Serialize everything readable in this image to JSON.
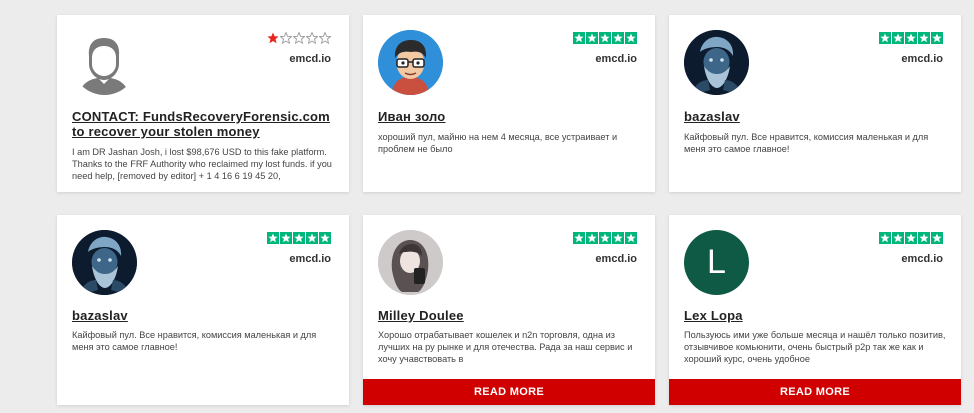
{
  "reviews": [
    {
      "name": "CONTACT: FundsRecoveryForensic.com to recover your stolen money",
      "site": "emcd.io",
      "rating": 1,
      "text": "I am DR Jashan Josh, i lost $98,676 USD to this fake platform. Thanks to the FRF Authority who reclaimed my lost funds. if you need help, [removed by editor] + 1 4 16 6 19 45 20,",
      "avatar": "default-person-icon"
    },
    {
      "name": "Иван золо",
      "site": "emcd.io",
      "rating": 5,
      "text": "хороший пул, майню на нем 4 месяца, все устраивает и проблем не было",
      "avatar": "cartoon-glasses-avatar"
    },
    {
      "name": "bazaslav",
      "site": "emcd.io",
      "rating": 5,
      "text": "Кайфовый пул. Все нравится, комиссия маленькая и для меня это самое главное!",
      "avatar": "poseidon-avatar"
    },
    {
      "name": "bazaslav",
      "site": "emcd.io",
      "rating": 5,
      "text": "Кайфовый пул. Все нравится, комиссия маленькая и для меня это самое главное!",
      "avatar": "poseidon-avatar"
    },
    {
      "name": "Milley Doulee",
      "site": "emcd.io",
      "rating": 5,
      "text": "Хорошо отрабатывает кошелек и n2n торговля, одна из лучших на ру рынке и для отечества. Рада за наш сервис и хочу учавствовать в",
      "avatar": "photo-avatar",
      "read_more": "READ MORE"
    },
    {
      "name": "Lex Lopa",
      "site": "emcd.io",
      "rating": 5,
      "text": "Пользуюсь ими уже больше месяца и нашёл только позитив, отзывчивое комьюнити, очень быстрый p2p так же как и хороший курс, очень удобное",
      "avatar_letter": "L",
      "read_more": "READ MORE"
    }
  ],
  "colors": {
    "star_green": "#00b67a",
    "star_red": "#e8251f",
    "read_more_bg": "#d10000",
    "letter_avatar_bg": "#0e5a44"
  }
}
